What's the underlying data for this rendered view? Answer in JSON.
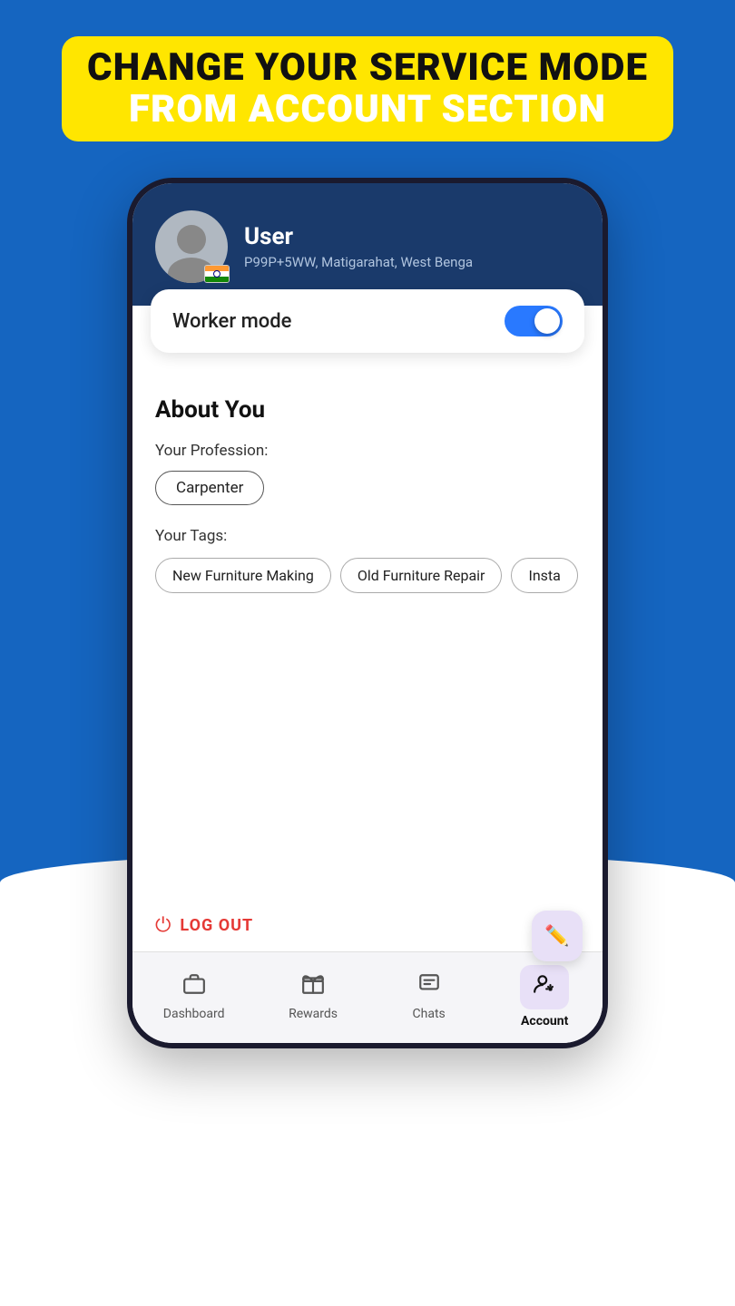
{
  "header": {
    "line1": "CHANGE YOUR SERVICE MODE",
    "line2": "FROM ACCOUNT SECTION"
  },
  "profile": {
    "name": "User",
    "location": "P99P+5WW, Matigarahat, West Benga",
    "flag": "🇮🇳"
  },
  "worker_mode": {
    "label": "Worker mode",
    "enabled": true
  },
  "about": {
    "title": "About You",
    "profession_label": "Your Profession:",
    "profession": "Carpenter",
    "tags_label": "Your Tags:",
    "tags": [
      "New Furniture Making",
      "Old Furniture Repair",
      "Insta..."
    ]
  },
  "logout": {
    "label": "LOG OUT"
  },
  "nav": {
    "items": [
      {
        "id": "dashboard",
        "label": "Dashboard",
        "icon": "briefcase"
      },
      {
        "id": "rewards",
        "label": "Rewards",
        "icon": "gift"
      },
      {
        "id": "chats",
        "label": "Chats",
        "icon": "chat"
      },
      {
        "id": "account",
        "label": "Account",
        "icon": "account",
        "active": true
      }
    ]
  }
}
